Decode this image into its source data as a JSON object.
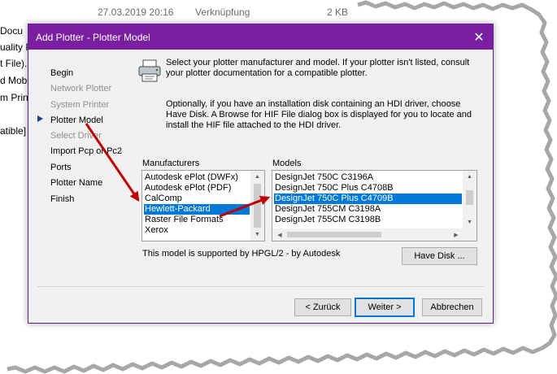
{
  "background": {
    "date": "27.03.2019 20:16",
    "type": "Verknüpfung",
    "size": "2 KB",
    "left_fragments": [
      "Docu",
      "uality P",
      "t File).",
      "d Mob",
      "m Prin",
      "atible]"
    ]
  },
  "dialog": {
    "title": "Add Plotter - Plotter Model",
    "close_glyph": "✕",
    "steps": [
      {
        "label": "Begin",
        "enabled": true
      },
      {
        "label": "Network Plotter",
        "enabled": false
      },
      {
        "label": "System Printer",
        "enabled": false
      },
      {
        "label": "Plotter Model",
        "enabled": true,
        "current": true
      },
      {
        "label": "Select Driver",
        "enabled": false
      },
      {
        "label": "Import Pcp or Pc2",
        "enabled": true
      },
      {
        "label": "Ports",
        "enabled": true
      },
      {
        "label": "Plotter Name",
        "enabled": true
      },
      {
        "label": "Finish",
        "enabled": true
      }
    ],
    "intro_text": "Select your plotter manufacturer and model. If your plotter isn't listed, consult your plotter documentation for a compatible plotter.",
    "hdi_text": "Optionally, if you have an installation disk containing an HDI driver, choose Have Disk. A Browse for HIF File dialog box is displayed for you to locate and install the HIF file attached to the HDI driver.",
    "manufacturers_label": "Manufacturers",
    "manufacturers": [
      "Autodesk ePlot (DWFx)",
      "Autodesk ePlot (PDF)",
      "CalComp",
      "Hewlett-Packard",
      "Raster File Formats",
      "Xerox"
    ],
    "selected_manufacturer": "Hewlett-Packard",
    "models_label": "Models",
    "models": [
      "DesignJet 750C C3196A",
      "DesignJet 750C Plus C4708B",
      "DesignJet 750C Plus C4709B",
      "DesignJet 755CM C3198A",
      "DesignJet 755CM C3198B"
    ],
    "selected_model": "DesignJet 750C Plus C4709B",
    "support_text": "This model is supported by HPGL/2 - by Autodesk",
    "have_disk_label": "Have Disk ...",
    "back_label": "< Zurück",
    "next_label": "Weiter >",
    "cancel_label": "Abbrechen"
  },
  "colors": {
    "titlebar": "#7b1fa2",
    "selection": "#0078d7",
    "annotation_arrow": "#c00000"
  }
}
